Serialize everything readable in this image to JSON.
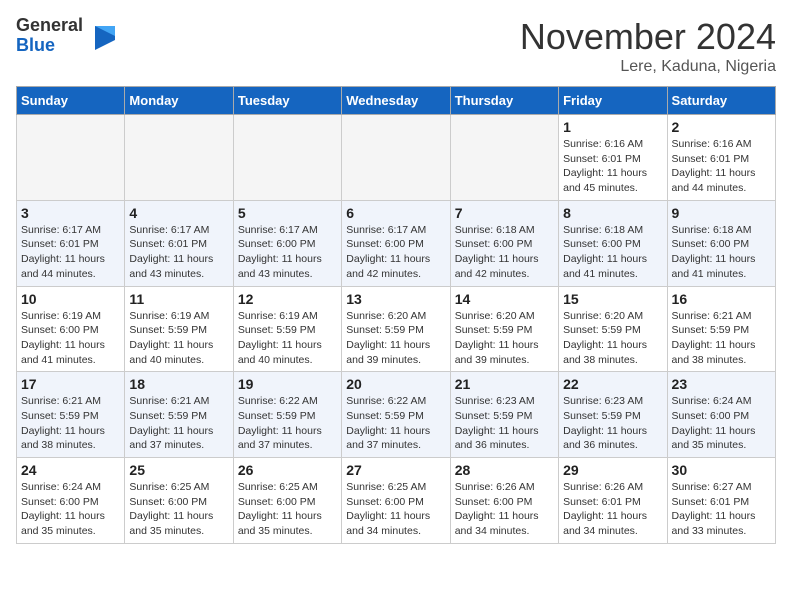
{
  "logo": {
    "general": "General",
    "blue": "Blue"
  },
  "header": {
    "month": "November 2024",
    "location": "Lere, Kaduna, Nigeria"
  },
  "weekdays": [
    "Sunday",
    "Monday",
    "Tuesday",
    "Wednesday",
    "Thursday",
    "Friday",
    "Saturday"
  ],
  "weeks": [
    [
      {
        "day": "",
        "info": ""
      },
      {
        "day": "",
        "info": ""
      },
      {
        "day": "",
        "info": ""
      },
      {
        "day": "",
        "info": ""
      },
      {
        "day": "",
        "info": ""
      },
      {
        "day": "1",
        "info": "Sunrise: 6:16 AM\nSunset: 6:01 PM\nDaylight: 11 hours\nand 45 minutes."
      },
      {
        "day": "2",
        "info": "Sunrise: 6:16 AM\nSunset: 6:01 PM\nDaylight: 11 hours\nand 44 minutes."
      }
    ],
    [
      {
        "day": "3",
        "info": "Sunrise: 6:17 AM\nSunset: 6:01 PM\nDaylight: 11 hours\nand 44 minutes."
      },
      {
        "day": "4",
        "info": "Sunrise: 6:17 AM\nSunset: 6:01 PM\nDaylight: 11 hours\nand 43 minutes."
      },
      {
        "day": "5",
        "info": "Sunrise: 6:17 AM\nSunset: 6:00 PM\nDaylight: 11 hours\nand 43 minutes."
      },
      {
        "day": "6",
        "info": "Sunrise: 6:17 AM\nSunset: 6:00 PM\nDaylight: 11 hours\nand 42 minutes."
      },
      {
        "day": "7",
        "info": "Sunrise: 6:18 AM\nSunset: 6:00 PM\nDaylight: 11 hours\nand 42 minutes."
      },
      {
        "day": "8",
        "info": "Sunrise: 6:18 AM\nSunset: 6:00 PM\nDaylight: 11 hours\nand 41 minutes."
      },
      {
        "day": "9",
        "info": "Sunrise: 6:18 AM\nSunset: 6:00 PM\nDaylight: 11 hours\nand 41 minutes."
      }
    ],
    [
      {
        "day": "10",
        "info": "Sunrise: 6:19 AM\nSunset: 6:00 PM\nDaylight: 11 hours\nand 41 minutes."
      },
      {
        "day": "11",
        "info": "Sunrise: 6:19 AM\nSunset: 5:59 PM\nDaylight: 11 hours\nand 40 minutes."
      },
      {
        "day": "12",
        "info": "Sunrise: 6:19 AM\nSunset: 5:59 PM\nDaylight: 11 hours\nand 40 minutes."
      },
      {
        "day": "13",
        "info": "Sunrise: 6:20 AM\nSunset: 5:59 PM\nDaylight: 11 hours\nand 39 minutes."
      },
      {
        "day": "14",
        "info": "Sunrise: 6:20 AM\nSunset: 5:59 PM\nDaylight: 11 hours\nand 39 minutes."
      },
      {
        "day": "15",
        "info": "Sunrise: 6:20 AM\nSunset: 5:59 PM\nDaylight: 11 hours\nand 38 minutes."
      },
      {
        "day": "16",
        "info": "Sunrise: 6:21 AM\nSunset: 5:59 PM\nDaylight: 11 hours\nand 38 minutes."
      }
    ],
    [
      {
        "day": "17",
        "info": "Sunrise: 6:21 AM\nSunset: 5:59 PM\nDaylight: 11 hours\nand 38 minutes."
      },
      {
        "day": "18",
        "info": "Sunrise: 6:21 AM\nSunset: 5:59 PM\nDaylight: 11 hours\nand 37 minutes."
      },
      {
        "day": "19",
        "info": "Sunrise: 6:22 AM\nSunset: 5:59 PM\nDaylight: 11 hours\nand 37 minutes."
      },
      {
        "day": "20",
        "info": "Sunrise: 6:22 AM\nSunset: 5:59 PM\nDaylight: 11 hours\nand 37 minutes."
      },
      {
        "day": "21",
        "info": "Sunrise: 6:23 AM\nSunset: 5:59 PM\nDaylight: 11 hours\nand 36 minutes."
      },
      {
        "day": "22",
        "info": "Sunrise: 6:23 AM\nSunset: 5:59 PM\nDaylight: 11 hours\nand 36 minutes."
      },
      {
        "day": "23",
        "info": "Sunrise: 6:24 AM\nSunset: 6:00 PM\nDaylight: 11 hours\nand 35 minutes."
      }
    ],
    [
      {
        "day": "24",
        "info": "Sunrise: 6:24 AM\nSunset: 6:00 PM\nDaylight: 11 hours\nand 35 minutes."
      },
      {
        "day": "25",
        "info": "Sunrise: 6:25 AM\nSunset: 6:00 PM\nDaylight: 11 hours\nand 35 minutes."
      },
      {
        "day": "26",
        "info": "Sunrise: 6:25 AM\nSunset: 6:00 PM\nDaylight: 11 hours\nand 35 minutes."
      },
      {
        "day": "27",
        "info": "Sunrise: 6:25 AM\nSunset: 6:00 PM\nDaylight: 11 hours\nand 34 minutes."
      },
      {
        "day": "28",
        "info": "Sunrise: 6:26 AM\nSunset: 6:00 PM\nDaylight: 11 hours\nand 34 minutes."
      },
      {
        "day": "29",
        "info": "Sunrise: 6:26 AM\nSunset: 6:01 PM\nDaylight: 11 hours\nand 34 minutes."
      },
      {
        "day": "30",
        "info": "Sunrise: 6:27 AM\nSunset: 6:01 PM\nDaylight: 11 hours\nand 33 minutes."
      }
    ]
  ]
}
